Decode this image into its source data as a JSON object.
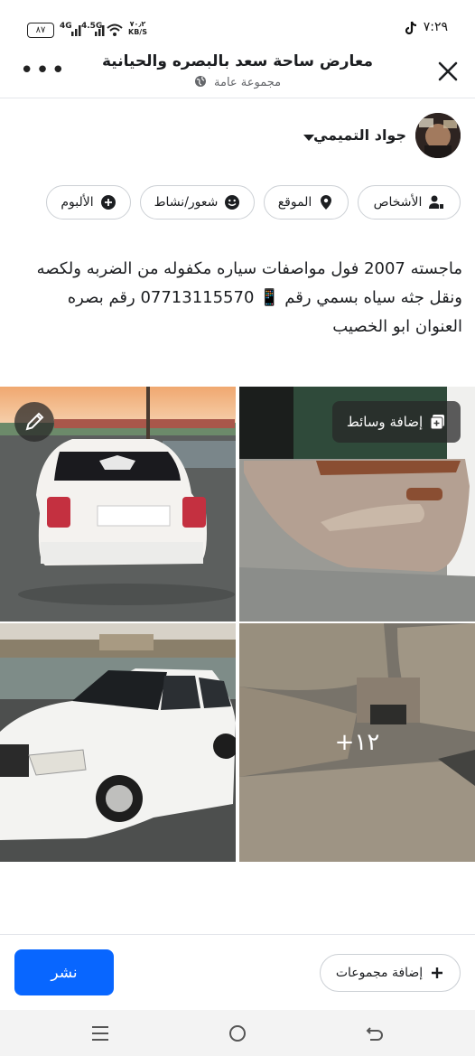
{
  "status_bar": {
    "time": "٧:٢٩",
    "battery": "٨٧",
    "network_1": "4G",
    "network_2": "4.5G",
    "speed": "٧٠٫٢",
    "speed_unit": "KB/S"
  },
  "header": {
    "title": "معارض ساحة سعد بالبصره والحيانية",
    "subtitle": "مجموعة عامة"
  },
  "author": {
    "name": "جواد التميمي"
  },
  "chips": [
    {
      "label": "الأشخاص",
      "icon": "people-tag-icon",
      "color": "#1c1e21"
    },
    {
      "label": "الموقع",
      "icon": "location-pin-icon",
      "color": "#1c1e21"
    },
    {
      "label": "شعور/نشاط",
      "icon": "smiley-icon",
      "color": "#1c1e21"
    },
    {
      "label": "الألبوم",
      "icon": "plus-circle-icon",
      "color": "#1c1e21"
    }
  ],
  "post": {
    "text": "ماجسته 2007 فول مواصفات سياره مكفوله من الضربه ولكصه ونقل جثه سياه بسمي رقم 📱 07713115570 رقم بصره العنوان ابو الخصيب"
  },
  "media": {
    "add_media_label": "إضافة وسائط",
    "more_count": "+١٢",
    "edit_icon": "pencil-icon"
  },
  "bottom": {
    "post_label": "نشر",
    "add_groups_label": "إضافة مجموعات"
  },
  "colors": {
    "accent": "#0866ff",
    "text": "#1c1e21",
    "secondary": "#65676b"
  }
}
